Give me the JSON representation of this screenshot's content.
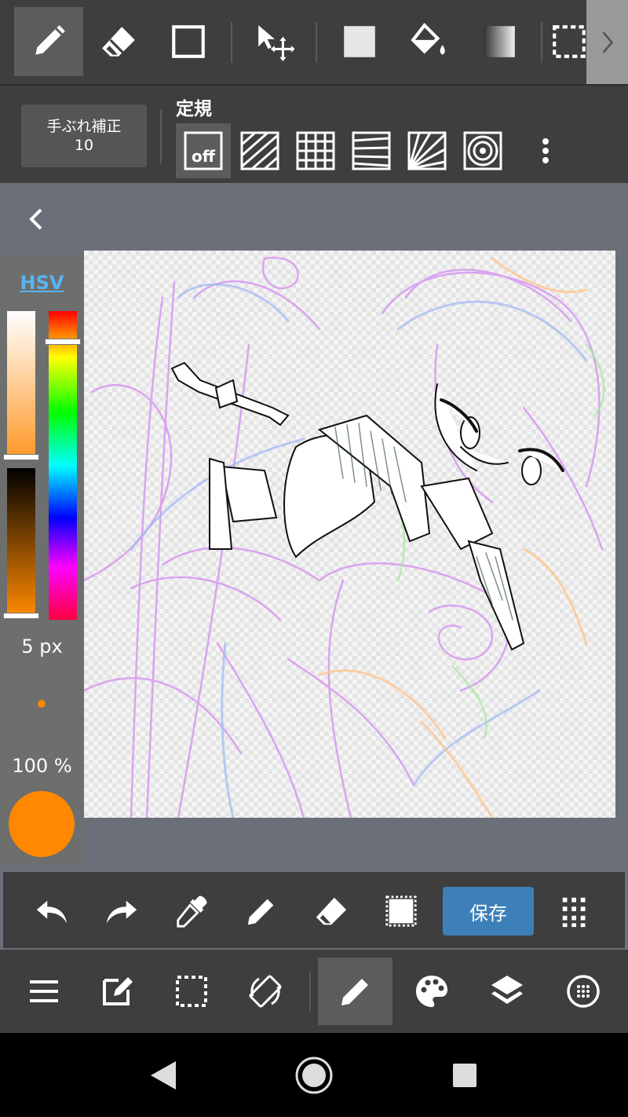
{
  "toolbar": {
    "tools": [
      {
        "name": "pen-tool",
        "icon": "pencil-icon",
        "active": true
      },
      {
        "name": "eraser-tool",
        "icon": "eraser-icon",
        "active": false
      },
      {
        "name": "shape-tool",
        "icon": "square-outline-icon",
        "active": false
      },
      {
        "name": "move-tool",
        "icon": "move-arrow-icon",
        "active": false
      },
      {
        "name": "fill-rect-tool",
        "icon": "filled-square-icon",
        "active": false
      },
      {
        "name": "bucket-tool",
        "icon": "paint-bucket-icon",
        "active": false
      },
      {
        "name": "gradient-tool",
        "icon": "gradient-icon",
        "active": false
      },
      {
        "name": "select-tool",
        "icon": "dashed-select-icon",
        "active": false
      }
    ]
  },
  "stabilizer": {
    "label": "手ぶれ補正",
    "value": "10"
  },
  "ruler": {
    "label": "定規",
    "off_label": "off",
    "options": [
      "off",
      "parallel",
      "grid",
      "perspective-parallel",
      "radial",
      "concentric"
    ]
  },
  "color_panel": {
    "mode_label": "HSV",
    "brush_size": "5 px",
    "opacity": "100 %",
    "current_color": "#ff8800",
    "saturation": 0.95,
    "value": 1.0,
    "hue_position": 0.1
  },
  "actions": {
    "save_label": "保存",
    "items": [
      "undo-icon",
      "redo-icon",
      "eyedropper-icon",
      "pencil-icon",
      "eraser-icon",
      "dotted-square-icon",
      "grid-dots-icon"
    ]
  },
  "bottom_nav": {
    "items": [
      "menu-icon",
      "edit-icon",
      "select-icon",
      "rotate-icon",
      "pencil-icon",
      "palette-icon",
      "layers-icon",
      "brush-icon"
    ],
    "active_index": 4
  },
  "colors": {
    "toolbar_bg": "#3e3e3e",
    "accent_blue": "#3d7fb8",
    "hsv_link": "#5ab4f0",
    "brush_color": "#ff8800"
  }
}
